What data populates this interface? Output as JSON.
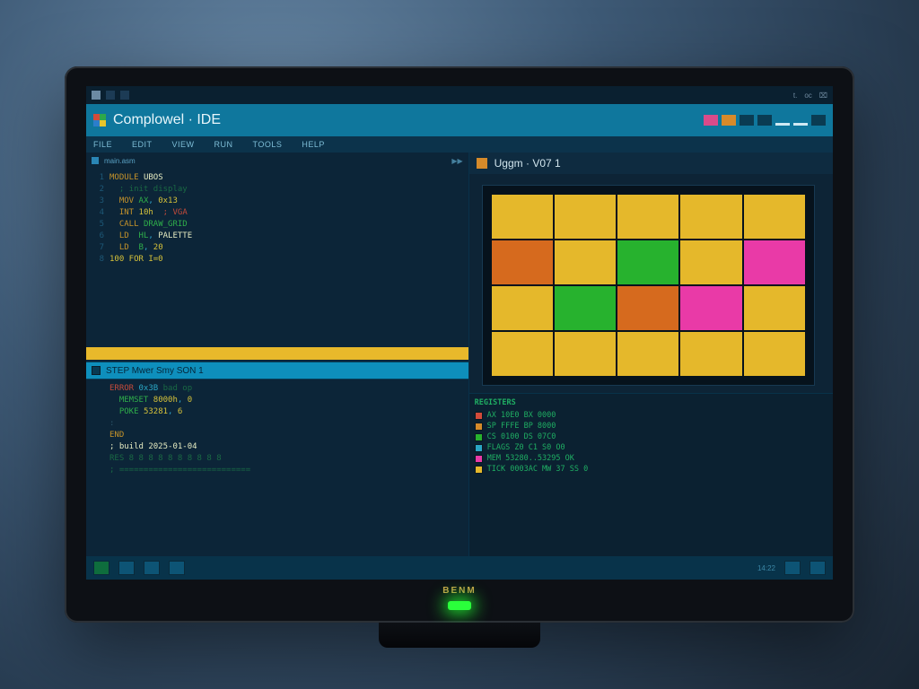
{
  "window": {
    "app_title": "Complowel · IDE",
    "brand": "BENM"
  },
  "top_tray": {
    "items": [
      "⠿",
      "□",
      "□"
    ],
    "right_labels": [
      "t.",
      "oc",
      "⌧"
    ]
  },
  "titlebar_controls": [
    "hot",
    "warm",
    "b",
    "b",
    "underscore",
    "underscore",
    "b"
  ],
  "menubar": [
    "FILE",
    "EDIT",
    "VIEW",
    "RUN",
    "TOOLS",
    "HELP"
  ],
  "left_pane": {
    "tab_label": "main.asm",
    "marker": "▶▶",
    "section_band": "STEP Mwer Smy SON 1",
    "code_top": [
      {
        "gutter": "1",
        "text": "<span class='kw'>MODULE</span> <span class='hi'>UBOS</span>"
      },
      {
        "gutter": "2",
        "text": "  <span class='cm'>; init display</span>"
      },
      {
        "gutter": "3",
        "text": "  <span class='kw'>MOV</span> <span class='str'>AX</span>, <span class='num'>0x13</span>"
      },
      {
        "gutter": "4",
        "text": "  <span class='kw'>INT</span> <span class='num'>10h</span>  <span class='err'>; VGA</span>"
      },
      {
        "gutter": "5",
        "text": "  <span class='kw'>CALL</span> <span class='str'>DRAW_GRID</span>"
      },
      {
        "gutter": "6",
        "text": "  <span class='kw'>LD</span>  <span class='str'>HL</span>, <span class='hi'>PALETTE</span>"
      },
      {
        "gutter": "7",
        "text": "  <span class='kw'>LD</span>  <span class='str'>B</span>, <span class='num'>20</span>"
      },
      {
        "gutter": "8",
        "text": "<span class='num'>100 FOR I=0</span>"
      }
    ],
    "code_bottom": [
      {
        "gutter": "",
        "text": "<span class='err'>ERROR</span> <span class='c-cy'>0x3B</span> <span class='cm'>bad op</span>"
      },
      {
        "gutter": "",
        "text": "  <span class='str'>MEMSET</span> <span class='num'>8000h</span>, <span class='num'>0</span>"
      },
      {
        "gutter": "",
        "text": "  <span class='str'>POKE</span> <span class='num'>53281</span>, <span class='num'>6</span>"
      },
      {
        "gutter": "",
        "text": "<span class='c-dim'>:</span>"
      },
      {
        "gutter": "",
        "text": "<span class='kw'>END</span>"
      },
      {
        "gutter": "",
        "text": "<span class='hi'>; build 2025-01-04</span>"
      },
      {
        "gutter": "",
        "text": "<span class='cm'>RES 8 8 8 8 8 8 8 8 8 8</span>"
      },
      {
        "gutter": "",
        "text": "<span class='cm'>; ===========================</span>"
      }
    ]
  },
  "right_pane": {
    "title": "Uggm · V07 1",
    "grid_colors": [
      "#e5b82b",
      "#e5b82b",
      "#e5b82b",
      "#e5b82b",
      "#e5b82b",
      "#d66a1e",
      "#e5b82b",
      "#27b22e",
      "#e5b82b",
      "#e93aa7",
      "#e5b82b",
      "#27b22e",
      "#d66a1e",
      "#e93aa7",
      "#e5b82b",
      "#e5b82b",
      "#e5b82b",
      "#e5b82b",
      "#e5b82b",
      "#e5b82b"
    ]
  },
  "console": {
    "header": "REGISTERS",
    "lines": [
      {
        "swatch": "#d24b3a",
        "text": "AX 10E0  BX 0000"
      },
      {
        "swatch": "#d58a2a",
        "text": "SP FFFE  BP 8000"
      },
      {
        "swatch": "#27b22e",
        "text": "CS 0100  DS 07C0"
      },
      {
        "swatch": "#2aa6c4",
        "text": "FLAGS  Z0 C1 S0 O0"
      },
      {
        "swatch": "#e93aa7",
        "text": "MEM 53280..53295  OK"
      },
      {
        "swatch": "#e5b82b",
        "text": "TICK 0003AC   MW 37 SS 0"
      }
    ]
  },
  "taskbar": {
    "clock": "14:22",
    "items": 5
  }
}
